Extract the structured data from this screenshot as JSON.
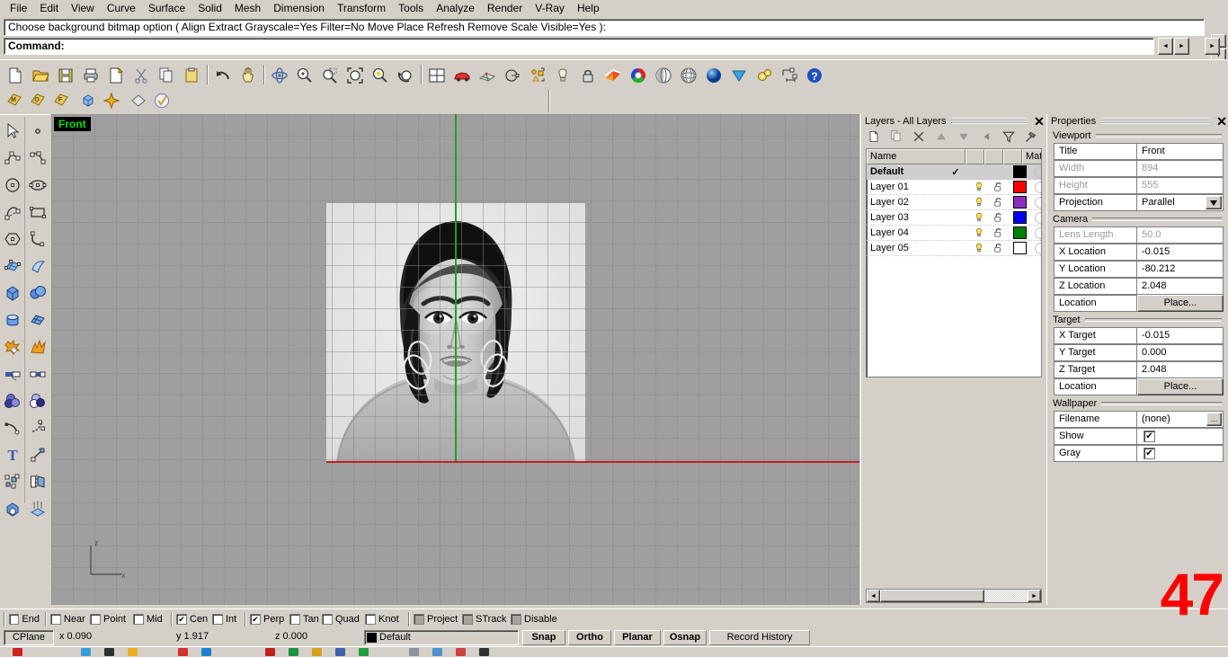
{
  "menu": {
    "items": [
      "File",
      "Edit",
      "View",
      "Curve",
      "Surface",
      "Solid",
      "Mesh",
      "Dimension",
      "Transform",
      "Tools",
      "Analyze",
      "Render",
      "V-Ray",
      "Help"
    ]
  },
  "command": {
    "history_line": "Choose background bitmap option ( Align  Extract  Grayscale=Yes  Filter=No  Move  Place  Refresh  Remove  Scale  Visible=Yes ):",
    "prompt_label": "Command:",
    "prompt_value": ""
  },
  "toolbar_main": {
    "icons": [
      "new-file-icon",
      "open-folder-icon",
      "save-icon",
      "print-icon",
      "print-preview-icon",
      "cut-icon",
      "copy-icon",
      "paste-icon",
      "undo-icon",
      "pan-icon",
      "rotate-view-icon",
      "zoom-in-icon",
      "zoom-window-icon",
      "zoom-extents-icon",
      "zoom-selected-icon",
      "zoom-previous-icon",
      "viewport-layout-icon",
      "car-render-icon",
      "mesh-icon",
      "circle-tool-icon",
      "object-snap-icon",
      "light-bulb-icon",
      "lock-icon",
      "gradient-icon",
      "color-wheel-icon",
      "shade-icon",
      "render-mesh-icon",
      "render-sphere-icon",
      "v-ray-icon",
      "v-ray-options-icon",
      "dimension-icon",
      "help-icon"
    ]
  },
  "toolbar_second": {
    "icons": [
      "tag-m-icon",
      "tag-o-icon",
      "tag-f-icon",
      "box-icon",
      "snapshot-icon",
      "surface-icon",
      "validate-icon"
    ]
  },
  "left_toolbar": {
    "icons": [
      "select-arrow-icon",
      "point-icon",
      "polyline-icon",
      "curve-icon",
      "circle-icon",
      "ellipse-icon",
      "arc-icon",
      "rectangle-icon",
      "polygon-icon",
      "curve-fillet-icon",
      "surface-grid-icon",
      "surface-sweep-icon",
      "box-solid-icon",
      "sphere-solid-icon",
      "cylinder-icon",
      "surface-planar-icon",
      "explode-icon",
      "blast-icon",
      "split-icon",
      "trim-icon",
      "boolean-union-icon",
      "boolean-difference-icon",
      "fillet-curve-icon",
      "blend-curve-icon",
      "text-icon",
      "connect-icon",
      "group-icon",
      "mirror-icon",
      "extrude-icon",
      "array-icon"
    ]
  },
  "viewport": {
    "label": "Front",
    "axis_z_label": "z",
    "axis_x_label": "x",
    "grid_color": "#8a8a8a",
    "background_color": "#9f9f9f",
    "x_axis_color": "#c02020",
    "y_axis_color": "#1fa01f",
    "wallpaper_alt": "grayscale-portrait-photo"
  },
  "layers_panel": {
    "title": "Layers - All Layers",
    "close_icon": "close-icon",
    "toolbar_icons": [
      "new-layer-icon",
      "duplicate-layer-icon",
      "delete-layer-icon",
      "move-up-icon",
      "move-down-icon",
      "back-arrow-icon",
      "filter-icon",
      "properties-hammer-icon",
      "help-question-icon"
    ],
    "columns": [
      "Name",
      "",
      "",
      "",
      "",
      "",
      "Mate"
    ],
    "rows": [
      {
        "name": "Default",
        "current": "✓",
        "on": false,
        "lock": false,
        "color": "#000000",
        "selected": true
      },
      {
        "name": "Layer 01",
        "current": "",
        "on": true,
        "lock": true,
        "color": "#ff0000",
        "selected": false
      },
      {
        "name": "Layer 02",
        "current": "",
        "on": true,
        "lock": true,
        "color": "#8c2fbe",
        "selected": false
      },
      {
        "name": "Layer 03",
        "current": "",
        "on": true,
        "lock": true,
        "color": "#0000ee",
        "selected": false
      },
      {
        "name": "Layer 04",
        "current": "",
        "on": true,
        "lock": true,
        "color": "#008000",
        "selected": false
      },
      {
        "name": "Layer 05",
        "current": "",
        "on": true,
        "lock": true,
        "color": "#ffffff",
        "selected": false
      }
    ]
  },
  "properties_panel": {
    "title": "Properties",
    "close_icon": "close-icon",
    "groups": [
      {
        "name": "Viewport",
        "rows": [
          {
            "label": "Title",
            "value": "Front",
            "dim": false,
            "type": "text"
          },
          {
            "label": "Width",
            "value": "894",
            "dim": true,
            "type": "text"
          },
          {
            "label": "Height",
            "value": "555",
            "dim": true,
            "type": "text"
          },
          {
            "label": "Projection",
            "value": "Parallel",
            "dim": false,
            "type": "dropdown"
          }
        ]
      },
      {
        "name": "Camera",
        "rows": [
          {
            "label": "Lens Length",
            "value": "50.0",
            "dim": true,
            "type": "text"
          },
          {
            "label": "X Location",
            "value": "-0.015",
            "dim": false,
            "type": "text"
          },
          {
            "label": "Y Location",
            "value": "-80.212",
            "dim": false,
            "type": "text"
          },
          {
            "label": "Z Location",
            "value": "2.048",
            "dim": false,
            "type": "text"
          },
          {
            "label": "Location",
            "value": "Place...",
            "dim": false,
            "type": "button"
          }
        ]
      },
      {
        "name": "Target",
        "rows": [
          {
            "label": "X Target",
            "value": "-0.015",
            "dim": false,
            "type": "text"
          },
          {
            "label": "Y Target",
            "value": "0.000",
            "dim": false,
            "type": "text"
          },
          {
            "label": "Z Target",
            "value": "2.048",
            "dim": false,
            "type": "text"
          },
          {
            "label": "Location",
            "value": "Place...",
            "dim": false,
            "type": "button"
          }
        ]
      },
      {
        "name": "Wallpaper",
        "rows": [
          {
            "label": "Filename",
            "value": "(none)",
            "dim": false,
            "type": "browse"
          },
          {
            "label": "Show",
            "value": "",
            "dim": false,
            "type": "checkbox",
            "checked": true
          },
          {
            "label": "Gray",
            "value": "",
            "dim": false,
            "type": "checkbox",
            "checked": true
          }
        ]
      }
    ]
  },
  "osnap_bar": {
    "items": [
      {
        "label": "End",
        "checked": false,
        "style": "normal"
      },
      {
        "label": "Near",
        "checked": false,
        "style": "normal"
      },
      {
        "label": "Point",
        "checked": false,
        "style": "normal"
      },
      {
        "label": "Mid",
        "checked": false,
        "style": "normal"
      },
      {
        "label": "Cen",
        "checked": true,
        "style": "normal"
      },
      {
        "label": "Int",
        "checked": false,
        "style": "normal"
      },
      {
        "label": "Perp",
        "checked": true,
        "style": "normal"
      },
      {
        "label": "Tan",
        "checked": false,
        "style": "normal"
      },
      {
        "label": "Quad",
        "checked": false,
        "style": "normal"
      },
      {
        "label": "Knot",
        "checked": false,
        "style": "normal"
      },
      {
        "label": "Project",
        "checked": false,
        "style": "grayed"
      },
      {
        "label": "STrack",
        "checked": false,
        "style": "grayed"
      },
      {
        "label": "Disable",
        "checked": false,
        "style": "grayed"
      }
    ]
  },
  "status_bar": {
    "cplane_label": "CPlane",
    "x_coord": "x 0.090",
    "y_coord": "y 1.917",
    "z_coord": "z 0.000",
    "layer_swatch_color": "#000000",
    "layer_name": "Default",
    "toggles": [
      {
        "label": "Snap",
        "active": true
      },
      {
        "label": "Ortho",
        "active": true
      },
      {
        "label": "Planar",
        "active": true
      },
      {
        "label": "Osnap",
        "active": true
      },
      {
        "label": "Record History",
        "active": false
      }
    ]
  },
  "watermark": {
    "text": "47",
    "color": "#ff0000"
  },
  "taskbar": {
    "icon_colors": [
      "#d02020",
      "#3a9ad9",
      "#303030",
      "#e8b020",
      "#d03030",
      "#2080d0",
      "#c02020",
      "#209040",
      "#d8a020",
      "#4060b0",
      "#20a040",
      "#9090a0",
      "#5090d0",
      "#d04040",
      "#303030"
    ]
  }
}
